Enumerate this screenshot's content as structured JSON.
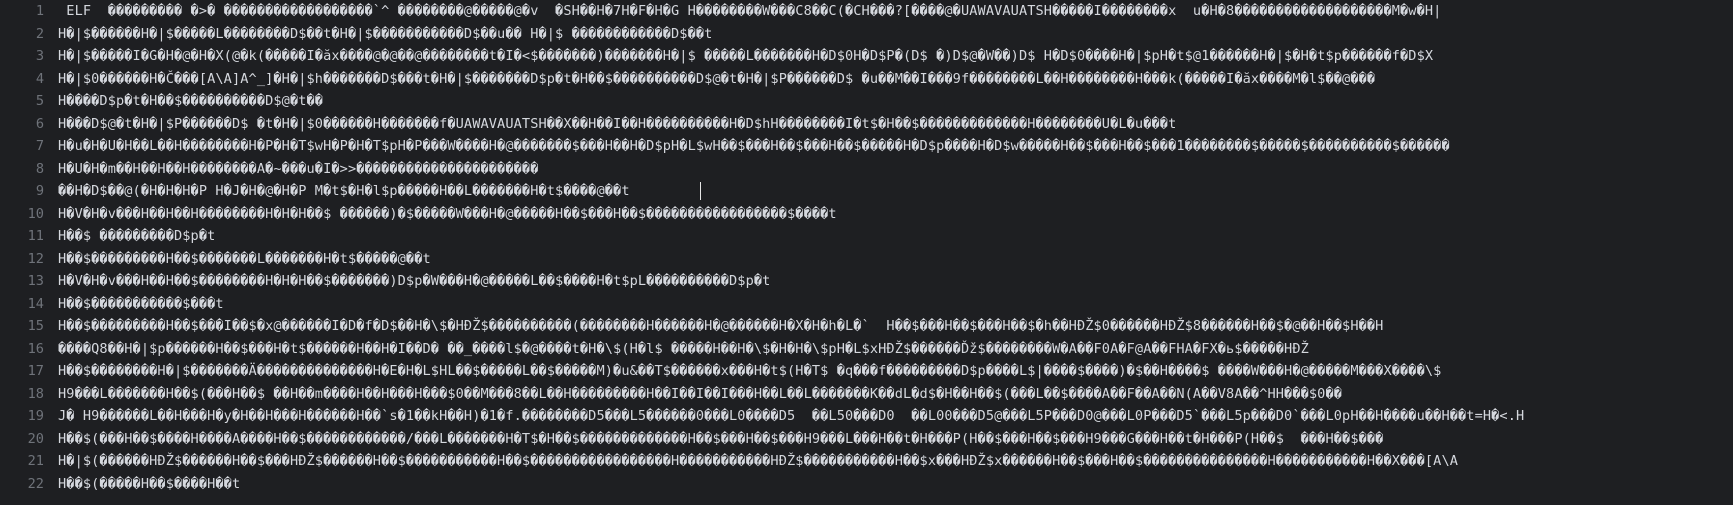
{
  "editor": {
    "line_numbers": [
      "1",
      "2",
      "3",
      "4",
      "5",
      "6",
      "7",
      "8",
      "9",
      "10",
      "11",
      "12",
      "13",
      "14",
      "15",
      "16",
      "17",
      "18",
      "19",
      "20",
      "21",
      "22"
    ],
    "lines": [
      " ELF  ��������� �>� ������������������`^ ��������@�����@�v  �SH��H�7H�F�H�G H��������W���C8��C(�CH���?[����@�UAWAVAUATSH�����I��������x  u�H�8�������������������M�w�H|",
      "H�|$������H�|$�����L��������D$��t�H�|$�����������D$��u�� H�|$ ������������D$��t",
      "H�|$�����I�G�H�@�H�X(@�k(�����I�ăx����@�@��@��������t�I�<$�������)�������H�|$ �����L�������H�D$0H�D$P�(D$ �)D$@�W��)D$ H�D$0����H�|$pH�t$@1������H�|$�H�t$p������f�D$X",
      "H�|$0������H�Č���[A\\A]A^_]�H�|$h�������D$���t�H�|$�������D$p�t�H��$����������D$@�t�H�|$P������D$ �u��M��I���9f��������L��H��������H���k(�����I�ăx����M�l$��@���",
      "H����D$p�t�H��$����������D$@�t��",
      "H���D$@�t�H�|$P������D$ �t�H�|$0������H�������f�UAWAVAUATSH��X��H��I��H����������H�D$hH��������I�t$�H��$�������������H��������U�L�u���t",
      "H�u�H�U�H��L��H��������H�P�H�T$wH�P�H�T$pH�P���W����H�@�������$���H��H�D$pH�L$wH��$���H��$���H��$�����H�D$p����H�D$w�����H��$���H��$���1��������$�����$����������$������",
      "H�U�H�m��H��H��H��������A�~���u�I�>>����������������������",
      "��H�D$��@(�H�H�H�P H�J�H�@�H�P M�t$�H�l$p�����H��L�������H�t$����@��t",
      "H�V�H�v���H��H��H��������H�H�H��$ ������)�$�����W���H�@�����H��$���H��$�����������������$����t",
      "H��$ ���������D$p�t",
      "H��$���������H��$�������L�������H�t$�����@��t",
      "H�V�H�v���H��H��$��������H�H�H��$�������)D$p�W���H�@�����L��$����H�t$pL����������D$p�t",
      "H��$�����������$���t",
      "H��$���������H��$���I��$�x@������I�D�f�D$��H�\\$�HĐŽ$����������(��������H������H�@������H�X�H�h�L�`  H��$���H��$���H��$�h��HĐŽ$0������HĐŽ$8������H��$�@��H��$H��H",
      "����Q8��H�|$p������H��$���H�t$������H��H�I��D� ��_����l$�@����t�H�\\$(H�l$ �����H��H�\\$�H�H�\\$pH�L$xHĐŽ$������Ďž$��������W�A��F0A�F@A��FHA�FX�ь$�����HĐŽ",
      "H��$��������H�|$�������Ä��������������H�E�H�L$HL��$�����L��$�����M)�u&��T$������x���H�t$(H�T$ �q���f���������D$p����L$|����$����)�$��H����$ ����W���H�@�����M���X����\\$",
      "H9���L�������H��$(���H��$ ��H��m����H��H���H���$0��M���8��L��H���������H��I��I��I���H��L��L�������K��dL�d$�H��H��$(���L��$����A��F��A��N(A��V8A��^HH���$0��",
      "J� H9������L��H���H�y�H��H���H������H��`s�1��kH��H)�1�f.��������D5���L5������0���L0����D5  ��L50���D0  ��L00���D5@���L5P���D0@���L0P���D5`���L5p���D0`���L0pH��H����u��H��t=H�<.H",
      "H��$(���H��$����H����A����H��$������������/���L�������H�T$�H��$�������������H��$���H��$���H9���L���H��t�H���P(H��$���H��$���H9���G���H��t�H���P(H��$  ���H��$���",
      "H�|$(������HĐŽ$������H��$���HĐŽ$������H��$�����������H��$�����������������H�����������HĐŽ$�����������H��$x���HĐŽ$x������H��$���H��$���������������H�����������H��X���[A\\A",
      "H��$(�����H��$����H��t"
    ]
  }
}
